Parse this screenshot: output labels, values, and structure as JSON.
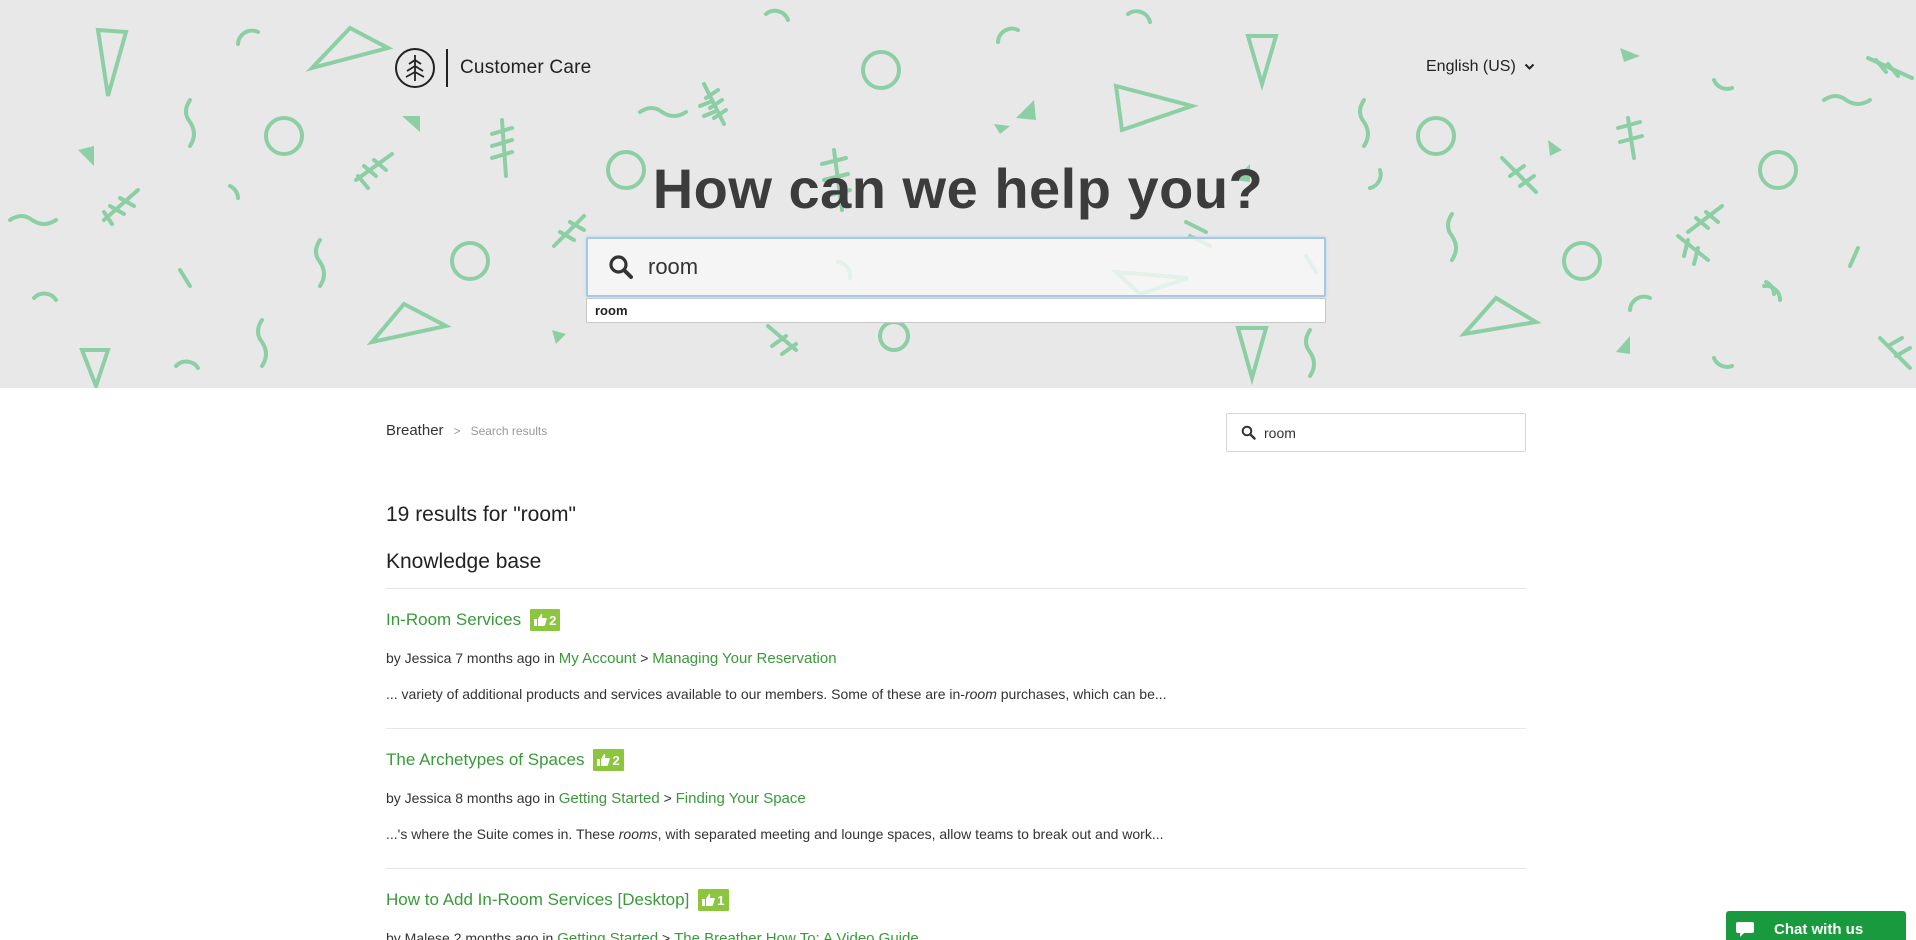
{
  "header": {
    "brand_name": "Customer Care",
    "language": "English (US)"
  },
  "hero": {
    "title": "How can we help you?",
    "search_value": "room",
    "autocomplete": [
      "room"
    ]
  },
  "breadcrumb": {
    "root": "Breather",
    "separator": ">",
    "current": "Search results"
  },
  "side_search": {
    "value": "room"
  },
  "results": {
    "heading": "19 results for \"room\"",
    "section": "Knowledge base",
    "items": [
      {
        "title": "In-Room Services",
        "votes": "2",
        "author_prefix": "by Jessica 7 months ago in",
        "category": "My Account",
        "crumb_sep": ">",
        "subcategory": "Managing Your Reservation",
        "snippet_before": "... variety of additional products and services available to our members. Some of these are in-",
        "snippet_highlight": "room",
        "snippet_after": " purchases, which can be..."
      },
      {
        "title": "The Archetypes of Spaces",
        "votes": "2",
        "author_prefix": "by Jessica 8 months ago in",
        "category": "Getting Started",
        "crumb_sep": ">",
        "subcategory": "Finding Your Space",
        "snippet_before": "...'s where the Suite comes in. These ",
        "snippet_highlight": "rooms",
        "snippet_after": ", with separated meeting and lounge spaces, allow teams to break out and work..."
      },
      {
        "title": "How to Add In-Room Services [Desktop]",
        "votes": "1",
        "author_prefix": "by Malese 2 months ago in",
        "category": "Getting Started",
        "crumb_sep": ">",
        "subcategory": "The Breather How To: A Video Guide",
        "snippet_before": "",
        "snippet_highlight": "",
        "snippet_after": ""
      }
    ]
  },
  "chat": {
    "label": "Chat with us"
  },
  "colors": {
    "accent": "#3a9a3a",
    "pattern": "#8dcfa5",
    "badge": "#8cc63f",
    "chat": "#1a9a3e"
  },
  "icons": {
    "logo": "tree-logo-icon",
    "search": "search-icon",
    "caret": "chevron-down-icon",
    "vote": "thumbs-up-icon",
    "chat": "chat-bubble-icon"
  }
}
